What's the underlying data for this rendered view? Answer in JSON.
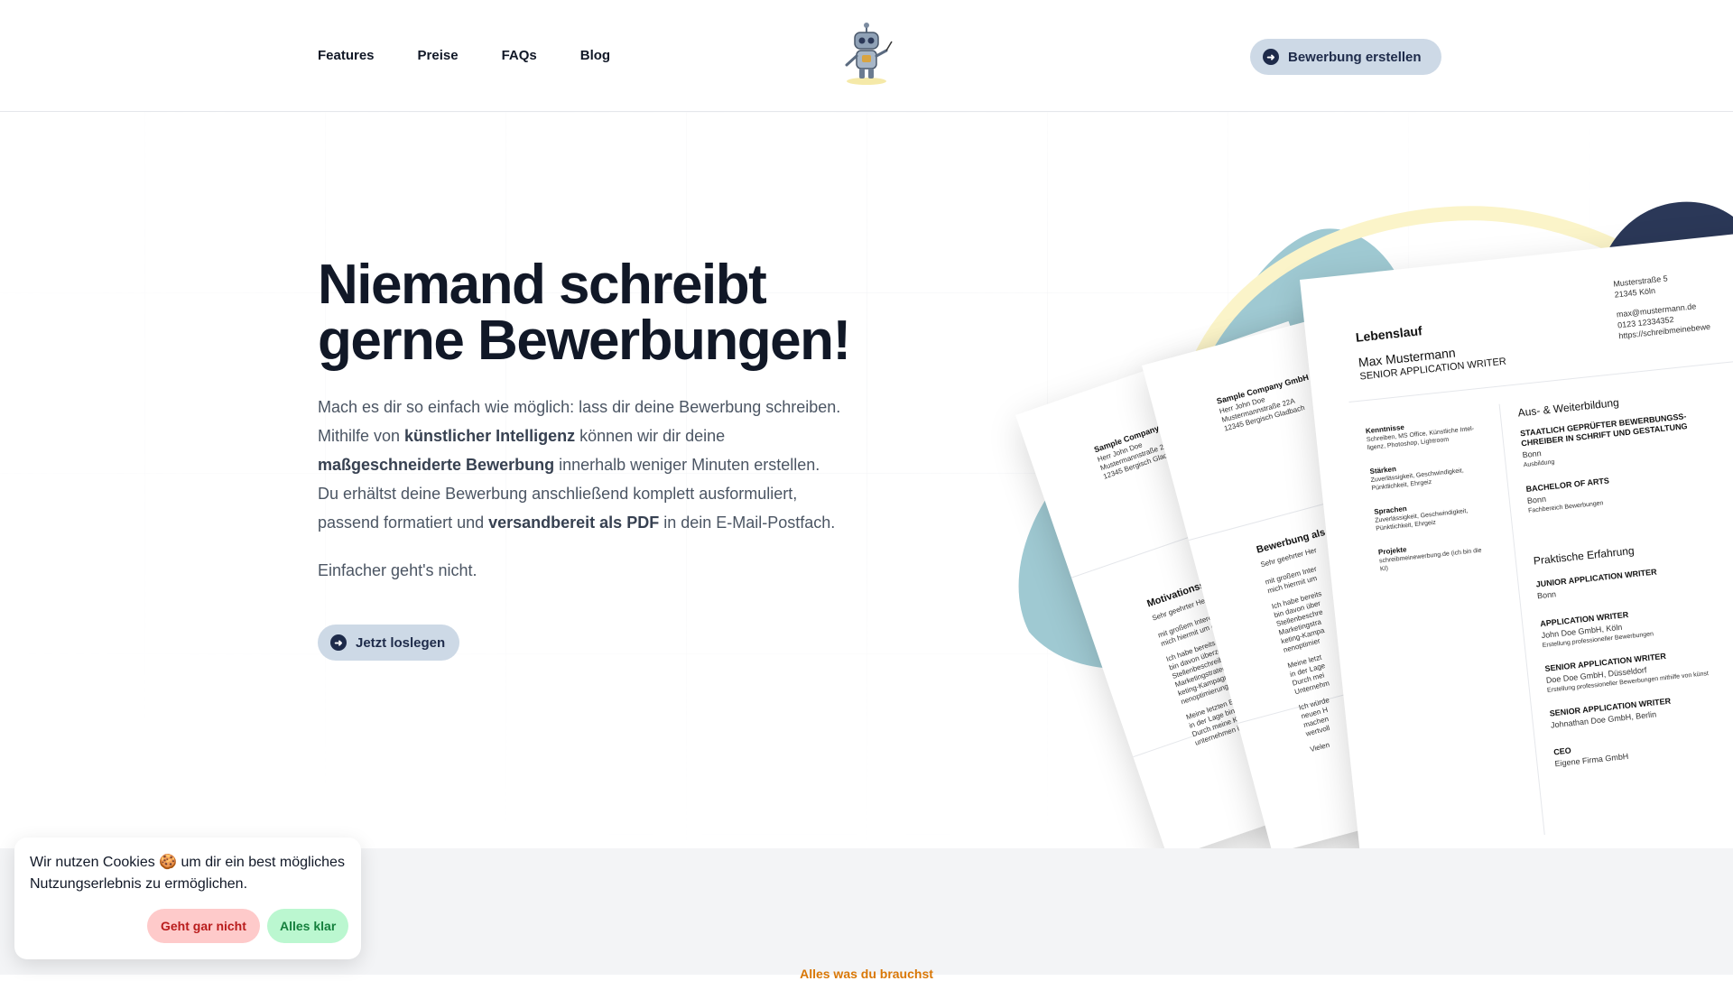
{
  "nav": {
    "items": [
      {
        "label": "Features"
      },
      {
        "label": "Preise"
      },
      {
        "label": "FAQs"
      },
      {
        "label": "Blog"
      }
    ],
    "cta_label": "Bewerbung erstellen"
  },
  "hero": {
    "headline_line1": "Niemand schreibt",
    "headline_line2": "gerne Bewerbungen!",
    "lead": {
      "p1": "Mach es dir so einfach wie möglich: lass dir deine Bewerbung schreiben. Mithilfe von ",
      "b1": "künstlicher Intelligenz",
      "p2": " können wir dir deine ",
      "b2": "maßgeschneiderte Bewerbung",
      "p3": " innerhalb weniger Minuten erstellen. Du erhältst deine Bewerbung anschließend komplett ausformuliert, passend formatiert und ",
      "b3": "versandbereit als PDF",
      "p4": " in dein E-Mail-Postfach."
    },
    "subline": "Einfacher geht's nicht.",
    "cta_label": "Jetzt loslegen"
  },
  "cv": {
    "title": "Lebenslauf",
    "name": "Max Mustermann",
    "role": "SENIOR APPLICATION WRITER",
    "address1": "Musterstraße 5",
    "address2": "21345 Köln",
    "email": "max@mustermann.de",
    "phone": "0123 12334352",
    "web": "https://schreibmeinebewe",
    "left": [
      {
        "h": "Kenntnisse",
        "l1": "Schreiben, MS Office, Künstliche Intel-",
        "l2": "ligenz, Photoshop, Lightroom"
      },
      {
        "h": "Stärken",
        "l1": "Zuverlässigkeit, Geschwindigkeit,",
        "l2": "Pünktlichkeit, Ehrgeiz"
      },
      {
        "h": "Sprachen",
        "l1": "Zuverlässigkeit, Geschwindigkeit,",
        "l2": "Pünktlichkeit, Ehrgeiz"
      },
      {
        "h": "Projekte",
        "l1": "schreibmeinewerbung.de (ich bin die",
        "l2": "KI)"
      }
    ],
    "edu_title": "Aus- & Weiterbildung",
    "edu": [
      {
        "h1": "STAATLICH GEPRÜFTER BEWERBUNGSS-",
        "h2": "CHREIBER IN SCHRIFT UND GESTALTUNG",
        "l1": "Bonn",
        "l2": "Ausbildung"
      },
      {
        "h1": "BACHELOR OF ARTS",
        "h2": "",
        "l1": "Bonn",
        "l2": "Fachbereich Bewerbungen"
      }
    ],
    "exp_title": "Praktische Erfahrung",
    "exp": [
      {
        "h": "JUNIOR APPLICATION WRITER",
        "l1": "Bonn",
        "l2": ""
      },
      {
        "h": "APPLICATION WRITER",
        "l1": "John Doe GmbH, Köln",
        "l2": "Erstellung professioneller Bewerbungen"
      },
      {
        "h": "SENIOR APPLICATION WRITER",
        "l1": "Doe Doe GmbH, Düsseldorf",
        "l2": "Erstellung professioneller Bewerbungen mithilfe von künst"
      },
      {
        "h": "SENIOR APPLICATION WRITER",
        "l1": "Johnathan Doe GmbH, Berlin",
        "l2": ""
      },
      {
        "h": "CEO",
        "l1": "Eigene Firma GmbH",
        "l2": ""
      }
    ]
  },
  "letter_mid": {
    "company": "Sample Company GmbH",
    "contact": "Herr John Doe",
    "street": "Mustermannstraße 22A",
    "city": "12345 Bergisch Gladbach",
    "subject": "Bewerbung als",
    "greeting": "Sehr geehrter Her",
    "lines": [
      "mit großem Inter",
      "mich hiermit um",
      "Ich habe bereits",
      "bin davon über",
      "Stellenbeschre",
      "Marketingstra",
      "keting-Kampa",
      "nenoptimier",
      "Meine letzt",
      "in der Lage",
      "Durch mei",
      "Unternehm",
      "Ich würde",
      "neuen H",
      "machen",
      "wertvoll",
      "Vielen"
    ]
  },
  "letter_back": {
    "company": "Sample Company GmbH",
    "contact": "Herr John Doe",
    "street": "Mustermannstraße 22A",
    "city": "12345 Bergisch Gladbach",
    "subject": "Motivationsschrei",
    "greeting": "Sehr geehrter Herr Mu",
    "lines": [
      "mit großem Interesse",
      "mich hiermit um die a",
      "Ich habe bereits meh",
      "bin davon überzeugt",
      "Stellenbeschreibung",
      "Marketingstrategien",
      "keting-Kampagnen.",
      "nenoptimierung un",
      "Meine letzten Erfol",
      "in der Lage bin, in",
      "Durch meine Krea",
      "unternehmen in"
    ]
  },
  "cookie": {
    "text": "Wir nutzen Cookies 🍪 um dir ein best mögliches Nutzungserlebnis zu ermöglichen.",
    "deny_label": "Geht gar nicht",
    "accept_label": "Alles klar"
  },
  "section": {
    "title": "Alles was du brauchst"
  },
  "colors": {
    "accent": "#cdd9e6",
    "accent_text": "#1e2b4a",
    "blob_teal": "#9fc9d2",
    "blob_navy": "#2b3858",
    "ring_yellow": "#fbf4c9",
    "section_title": "#d97706"
  },
  "icons": {
    "cta": "arrow-right-circle-icon",
    "logo": "robot-logo-icon"
  }
}
